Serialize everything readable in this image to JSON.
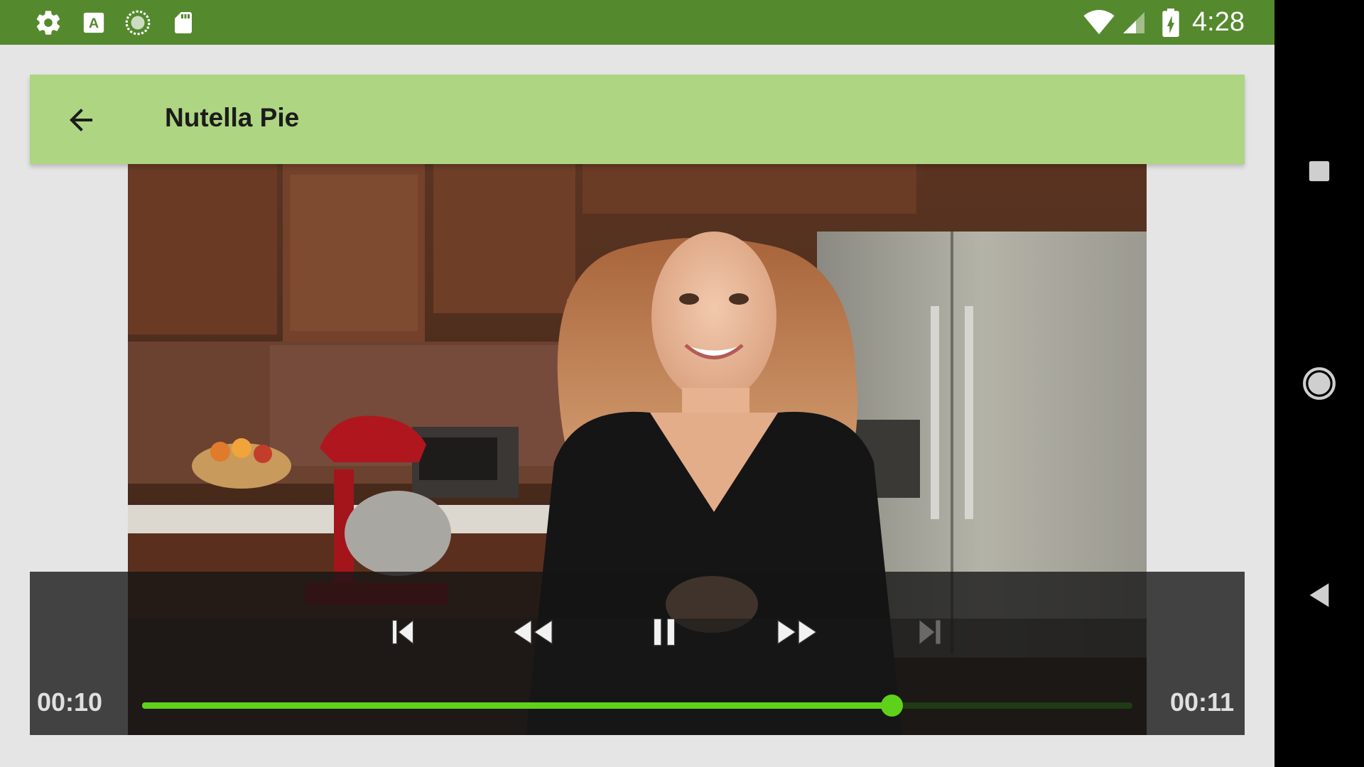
{
  "status_bar": {
    "time": "4:28",
    "left_icons": [
      "gear-icon",
      "text-a-icon",
      "sync-icon",
      "sd-card-icon"
    ],
    "right_icons": [
      "wifi-icon",
      "signal-icon",
      "battery-charging-icon"
    ],
    "background": "#55892d"
  },
  "toolbar": {
    "title": "Nutella Pie",
    "back_icon": "arrow-left-icon",
    "background": "#aed581"
  },
  "player": {
    "elapsed": "00:10",
    "duration": "00:11",
    "progress": 0.757,
    "buttons": [
      "skip-previous",
      "rewind",
      "pause",
      "fast-forward",
      "skip-next"
    ],
    "skip_next_enabled": false,
    "accent": "#5fd11a"
  },
  "nav_bar": {
    "buttons": [
      "recents",
      "home",
      "back"
    ]
  }
}
